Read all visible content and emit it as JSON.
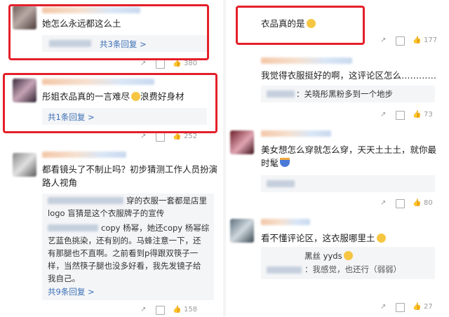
{
  "left": {
    "c1": {
      "text": "她怎么永远都这么土",
      "reply_link": "共3条回复 >",
      "likes": "380"
    },
    "c2": {
      "text": "彤姐衣品真的一言难尽",
      "text_after_emoji": "浪费好身材",
      "reply_link": "共1条回复 >",
      "likes": "252"
    },
    "c3": {
      "text_line1": "都看镜头了不制止吗？初步猜测工作人员扮演",
      "text_line2": "路人视角",
      "reply1_line1": "穿的衣服一套都是店里",
      "reply1_line2": "logo 盲猜是这个衣服牌子的宣传",
      "reply2_line1": "copy 杨幂，她还copy 杨幂综",
      "reply2_line2": "艺蓝色挑染，还有别的。马蜂注意一下，还",
      "reply2_line3": "有那腿也不直啊。之前看到p得跟双筷子一",
      "reply2_line4": "样，当然筷子腿也没多好看，我先发镜子给",
      "reply2_line5": "我自己。",
      "reply_link": "共9条回复 >",
      "likes": "158"
    }
  },
  "right": {
    "c1": {
      "text": "衣品真的是",
      "likes": "177"
    },
    "c2": {
      "text": "我觉得衣服挺好的啊，这评论区怎么…………",
      "reply": "：关晓彤黑粉多到一个地步",
      "likes": "73"
    },
    "c3": {
      "text_line1": "美女想怎么穿就怎么穿，天天土土土，就你最",
      "text_line2": "时髦",
      "likes": "80"
    },
    "c4": {
      "text": "看不懂评论区，这衣服哪里土",
      "reply1": "黑丝 yyds",
      "reply2": "：我感觉，也还行（弱弱）",
      "likes": "27"
    }
  },
  "colors": {
    "highlight": "#e4202a",
    "link": "#3a6fb5",
    "muted": "#9a9a9a"
  }
}
